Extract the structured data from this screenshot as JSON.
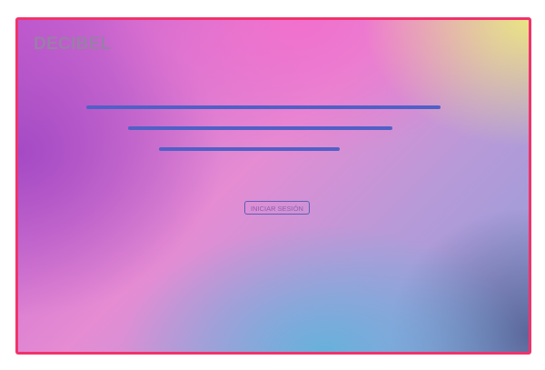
{
  "brand": {
    "logo_text": "DECIBEL"
  },
  "hero": {
    "placeholder_lines": 3
  },
  "actions": {
    "login_label": "INICIAR SESIÓN"
  },
  "colors": {
    "frame_border": "#f0336c",
    "line_color": "#5160c6",
    "logo_color": "#9a7ea8",
    "button_border": "#5a5fb8",
    "button_text": "#8b5fb0"
  }
}
